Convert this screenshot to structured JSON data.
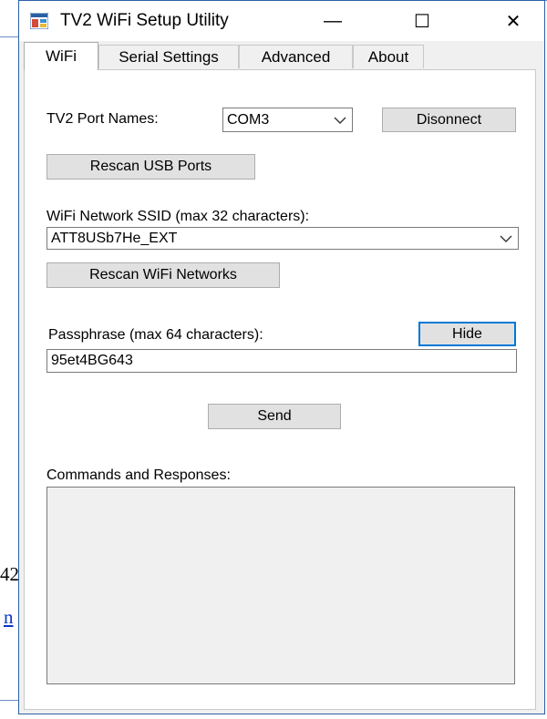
{
  "background": {
    "fragment_number": "42",
    "fragment_link": "n"
  },
  "window": {
    "title": "TV2 WiFi Setup Utility",
    "minimize_glyph": "—",
    "maximize_glyph": "☐",
    "close_glyph": "✕",
    "icon": "app-window-icon"
  },
  "tabs": [
    {
      "label": "WiFi",
      "active": true
    },
    {
      "label": "Serial Settings",
      "active": false
    },
    {
      "label": "Advanced",
      "active": false
    },
    {
      "label": "About",
      "active": false
    }
  ],
  "wifi": {
    "port_label": "TV2 Port Names:",
    "port_value": "COM3",
    "disconnect_label": "Disonnect",
    "rescan_usb_label": "Rescan USB Ports",
    "ssid_label": "WiFi Network SSID (max 32 characters):",
    "ssid_value": "ATT8USb7He_EXT",
    "rescan_wifi_label": "Rescan WiFi Networks",
    "passphrase_label": "Passphrase (max 64 characters):",
    "hide_label": "Hide",
    "passphrase_value": "95et4BG643",
    "send_label": "Send",
    "console_label": "Commands and Responses:",
    "console_text": ""
  },
  "colors": {
    "accent": "#0078d7",
    "window_border": "#2b5fa5",
    "link": "#0b35c4"
  }
}
